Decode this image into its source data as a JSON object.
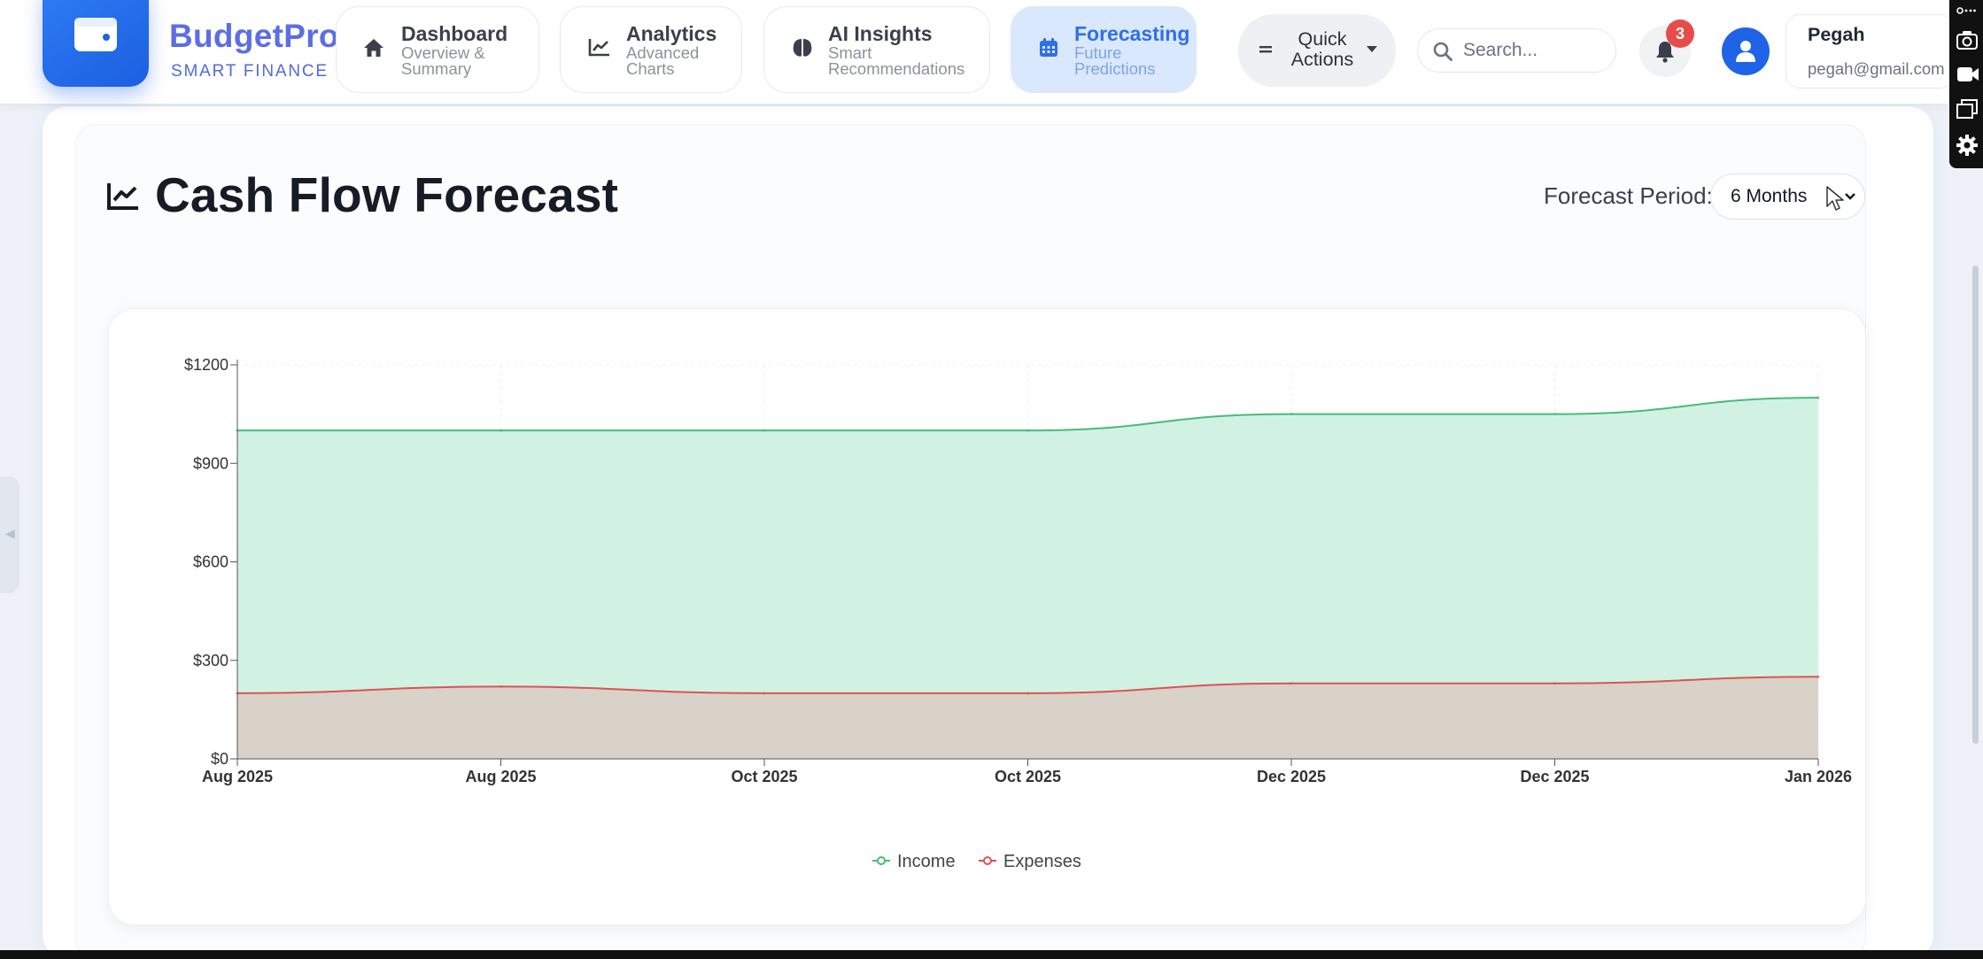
{
  "brand": {
    "name": "BudgetPro",
    "tagline": "SMART FINANCE"
  },
  "nav": [
    {
      "title": "Dashboard",
      "subtitle": "Overview & Summary",
      "icon": "home-icon",
      "active": false
    },
    {
      "title": "Analytics",
      "subtitle": "Advanced Charts",
      "icon": "chart-line-icon",
      "active": false
    },
    {
      "title": "AI Insights",
      "subtitle": "Smart Recommendations",
      "icon": "brain-icon",
      "active": false
    },
    {
      "title": "Forecasting",
      "subtitle": "Future Predictions",
      "icon": "calendar-icon",
      "active": true
    }
  ],
  "quick_actions": {
    "label": "Quick Actions"
  },
  "search": {
    "placeholder": "Search..."
  },
  "notifications": {
    "count": "3"
  },
  "user": {
    "name": "Pegah",
    "email": "pegah@gmail.com"
  },
  "page": {
    "title": "Cash Flow Forecast",
    "period_label": "Forecast Period:",
    "period_value": "6 Months"
  },
  "colors": {
    "accent": "#2f6fe8",
    "income": "#48bb78",
    "expenses": "#e05252"
  },
  "chart_data": {
    "type": "area",
    "x": [
      "Aug 2025",
      "Aug 2025",
      "Oct 2025",
      "Oct 2025",
      "Dec 2025",
      "Dec 2025",
      "Jan 2026"
    ],
    "series": [
      {
        "name": "Income",
        "values": [
          1000,
          1000,
          1000,
          1000,
          1050,
          1050,
          1100
        ]
      },
      {
        "name": "Expenses",
        "values": [
          200,
          220,
          200,
          200,
          230,
          230,
          250
        ]
      }
    ],
    "y_ticks": [
      "$0",
      "$300",
      "$600",
      "$900",
      "$1200"
    ],
    "ylim": [
      0,
      1200
    ],
    "grid": true,
    "legend": "bottom-center"
  }
}
